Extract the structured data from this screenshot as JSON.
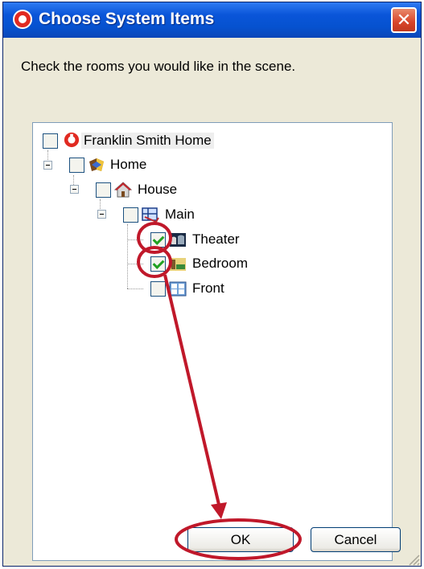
{
  "window": {
    "title": "Choose System Items",
    "close_glyph": "✕"
  },
  "prompt": "Check the rooms you would like in the scene.",
  "tree": {
    "root": {
      "label": "Franklin Smith Home",
      "checked": false,
      "icon": "system-logo-icon"
    },
    "home": {
      "label": "Home",
      "checked": false,
      "icon": "home-shield-icon"
    },
    "house": {
      "label": "House",
      "checked": false,
      "icon": "house-icon"
    },
    "main": {
      "label": "Main",
      "checked": false,
      "icon": "floor-icon"
    },
    "rooms": [
      {
        "label": "Theater",
        "checked": true,
        "icon": "theater-icon"
      },
      {
        "label": "Bedroom",
        "checked": true,
        "icon": "bedroom-icon"
      },
      {
        "label": "Front",
        "checked": false,
        "icon": "front-door-icon"
      }
    ]
  },
  "buttons": {
    "ok": "OK",
    "cancel": "Cancel"
  },
  "colors": {
    "annotation": "#c0182a",
    "title_bar": "#0a55d9",
    "dialog_bg": "#ece9d8"
  }
}
